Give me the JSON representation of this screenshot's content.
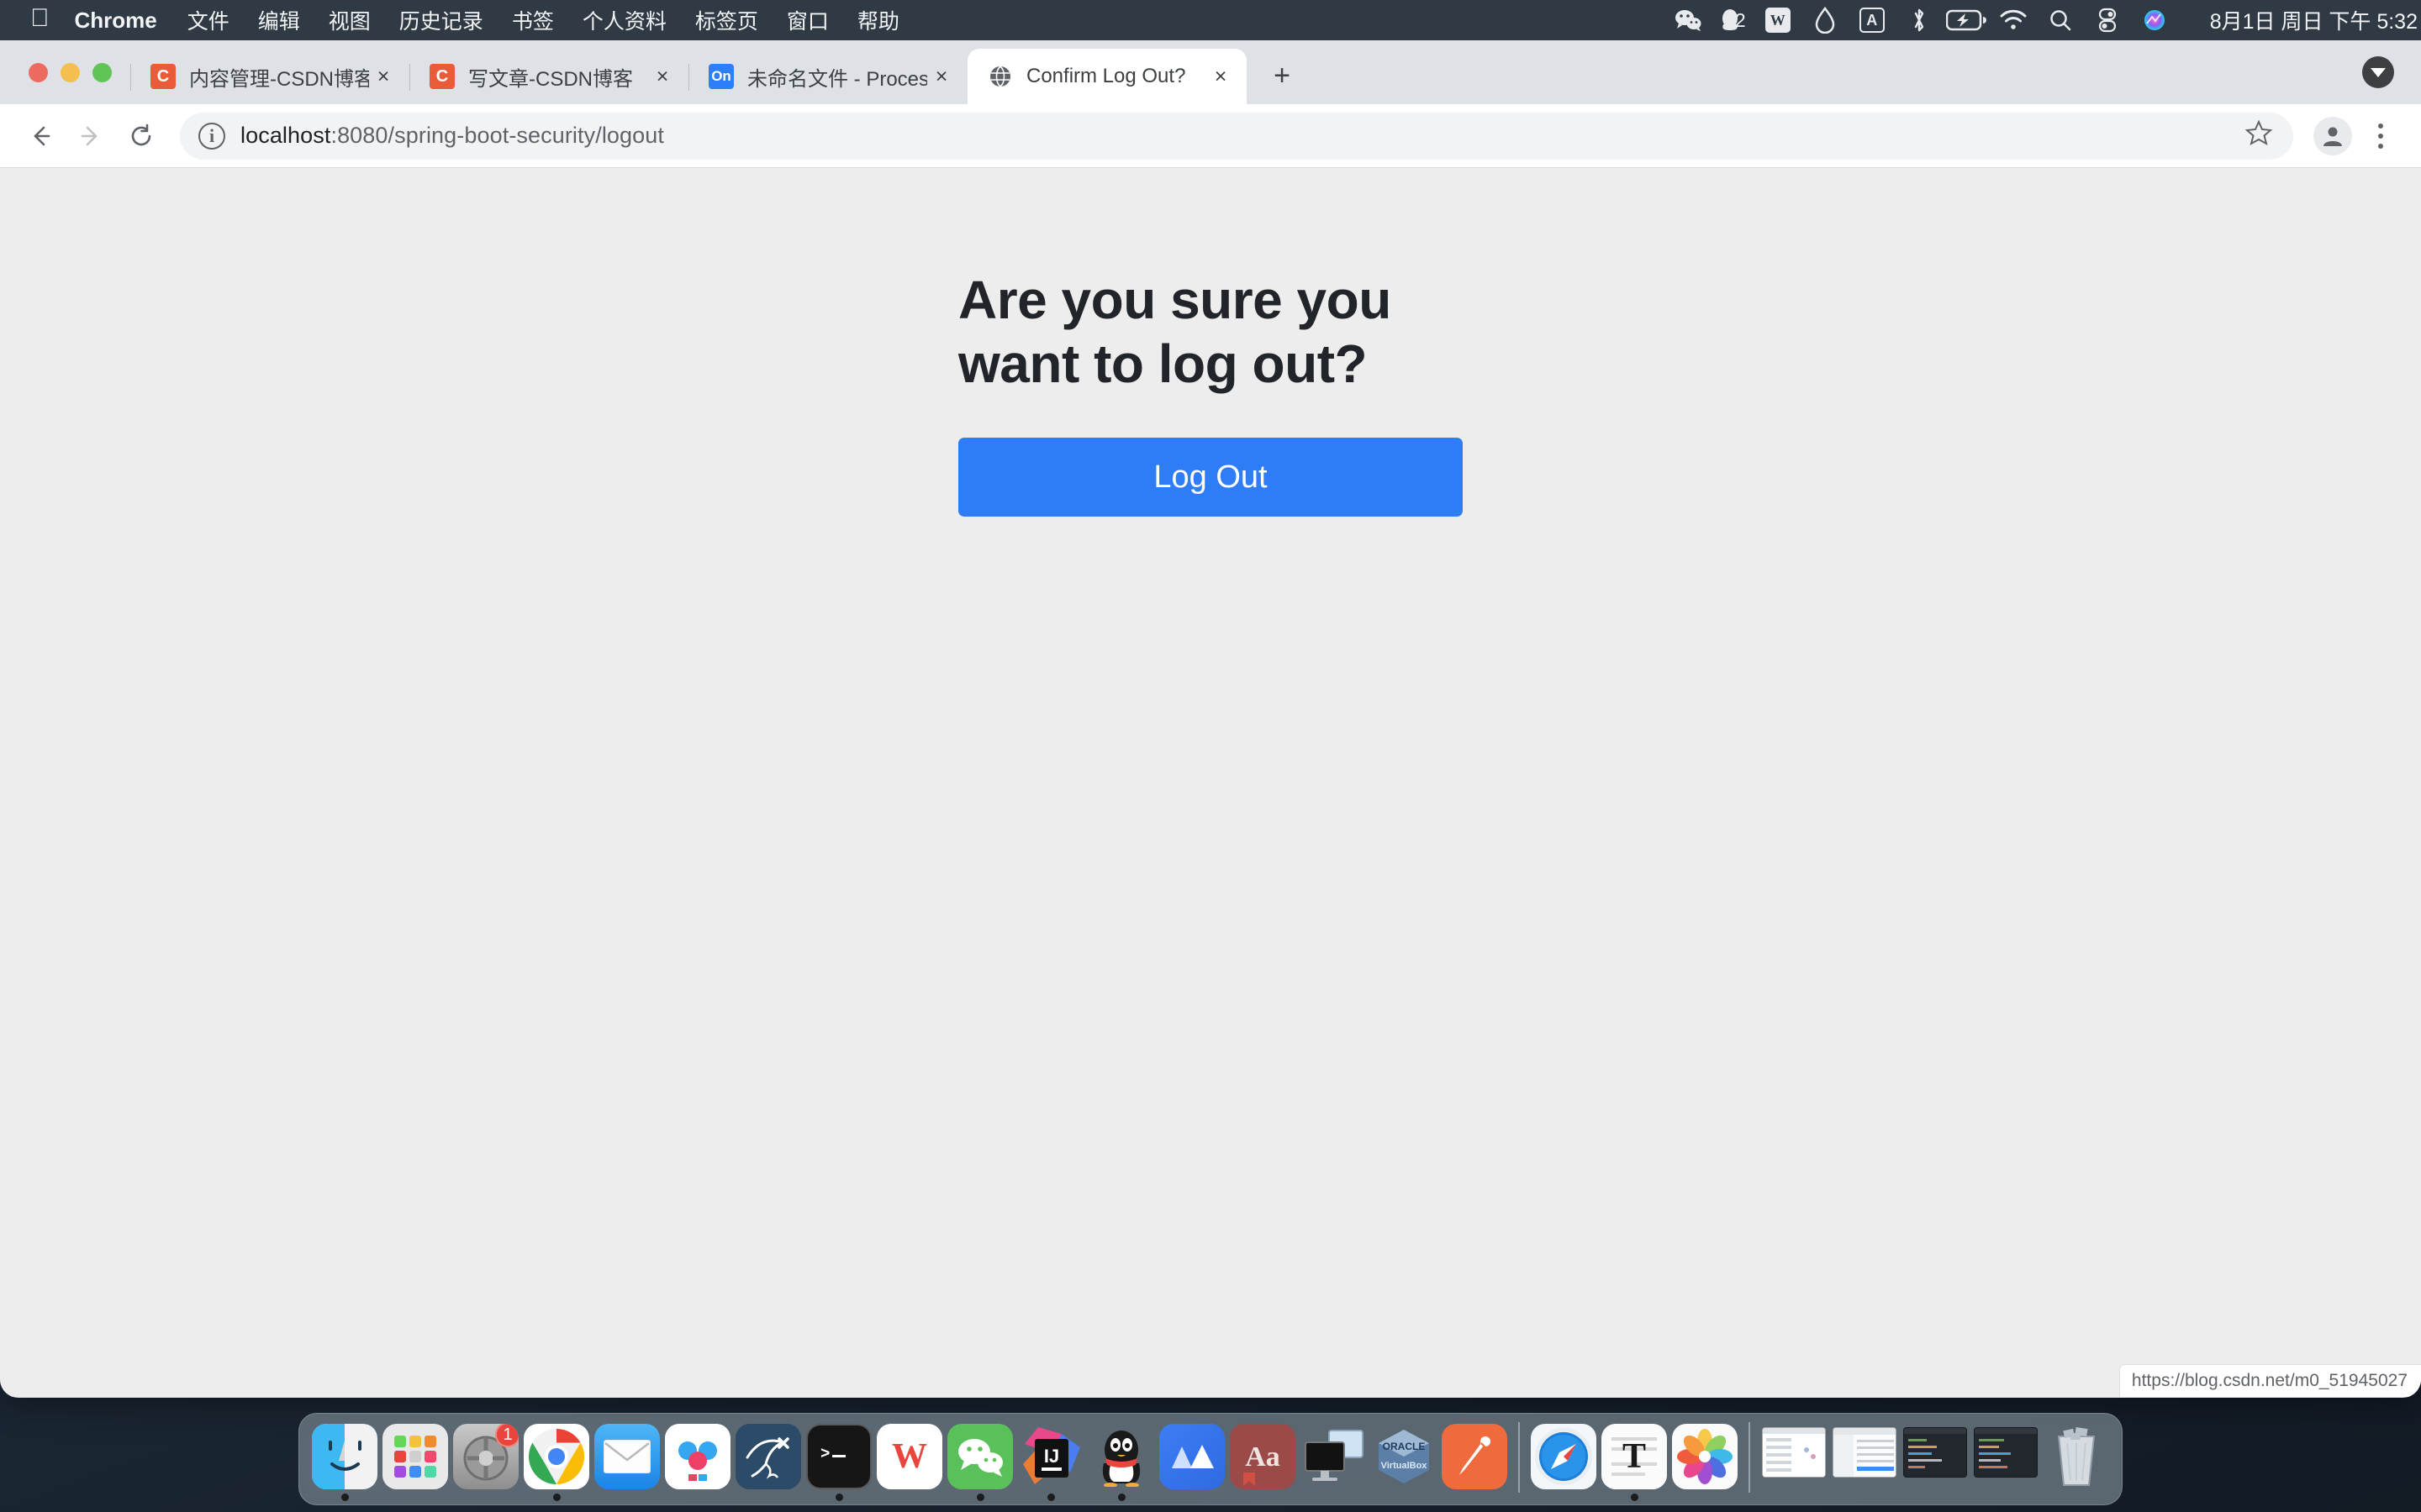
{
  "menubar": {
    "apple_icon": "apple-logo",
    "app_name": "Chrome",
    "items": [
      "文件",
      "编辑",
      "视图",
      "历史记录",
      "书签",
      "个人资料",
      "标签页",
      "窗口",
      "帮助"
    ],
    "tray": [
      {
        "name": "wechat-icon",
        "glyph": "💬"
      },
      {
        "name": "qq-icon",
        "glyph": "🐧",
        "badge": "2"
      },
      {
        "name": "wps-icon",
        "glyph": "W"
      },
      {
        "name": "onedrive-icon",
        "glyph": "◇"
      },
      {
        "name": "input-source-icon",
        "glyph": "A"
      },
      {
        "name": "bluetooth-icon",
        "glyph": "✱"
      },
      {
        "name": "battery-icon",
        "glyph": "⚡"
      },
      {
        "name": "wifi-icon",
        "glyph": "wifi"
      },
      {
        "name": "spotlight-search-icon",
        "glyph": "search"
      },
      {
        "name": "control-center-icon",
        "glyph": "cc"
      },
      {
        "name": "siri-icon",
        "glyph": "siri"
      }
    ],
    "datetime": "8月1日 周日 下午 5:32"
  },
  "window_controls": {
    "close": "close-window",
    "minimize": "minimize-window",
    "maximize": "maximize-window"
  },
  "tabs": [
    {
      "favicon": "csdn-favicon",
      "favicon_text": "C",
      "title": "内容管理-CSDN博客",
      "active": false,
      "close": "×"
    },
    {
      "favicon": "csdn-favicon",
      "favicon_text": "C",
      "title": "写文章-CSDN博客",
      "active": false,
      "close": "×"
    },
    {
      "favicon": "processon-favicon",
      "favicon_text": "On",
      "title": "未命名文件 - ProcessOn",
      "active": false,
      "close": "×"
    },
    {
      "favicon": "globe-favicon",
      "favicon_text": "🌐",
      "title": "Confirm Log Out?",
      "active": true,
      "close": "×"
    }
  ],
  "new_tab_label": "+",
  "toolbar": {
    "back": "←",
    "forward": "→",
    "reload": "⟳",
    "site_info_icon": "i",
    "url_host": "localhost",
    "url_path": ":8080/spring-boot-security/logout",
    "url_full": "localhost:8080/spring-boot-security/logout",
    "bookmark_star": "☆",
    "profile_icon": "person-icon",
    "menu_icon": "three-dot-menu"
  },
  "page": {
    "heading": "Are you sure you want to log out?",
    "logout_button": "Log Out",
    "background_color": "#ededed",
    "button_color": "#2f7df6",
    "heading_color": "#212529"
  },
  "status_bar": {
    "url": "https://blog.csdn.net/m0_51945027"
  },
  "dock": {
    "items": [
      {
        "name": "finder",
        "running": true
      },
      {
        "name": "launchpad",
        "running": false
      },
      {
        "name": "system-preferences",
        "running": false,
        "badge": "1"
      },
      {
        "name": "google-chrome",
        "running": true
      },
      {
        "name": "mail",
        "running": false
      },
      {
        "name": "baidu-netdisk",
        "running": false
      },
      {
        "name": "mysql-workbench",
        "running": false
      },
      {
        "name": "terminal",
        "running": true
      },
      {
        "name": "wps-office",
        "running": false
      },
      {
        "name": "wechat",
        "running": true
      },
      {
        "name": "intellij-idea",
        "running": true
      },
      {
        "name": "qq",
        "running": true
      },
      {
        "name": "motrix",
        "running": false
      },
      {
        "name": "dictionary",
        "running": false
      },
      {
        "name": "screen-sharing",
        "running": false
      },
      {
        "name": "virtualbox",
        "running": false
      },
      {
        "name": "markdown-editor",
        "running": false
      },
      {
        "name": "safari",
        "running": false
      },
      {
        "name": "textedit",
        "running": true
      },
      {
        "name": "photos",
        "running": false
      }
    ],
    "minimized": [
      {
        "name": "qq-window"
      },
      {
        "name": "finder-window"
      },
      {
        "name": "intellij-window-1"
      },
      {
        "name": "intellij-window-2"
      }
    ],
    "trash": {
      "name": "trash"
    }
  }
}
